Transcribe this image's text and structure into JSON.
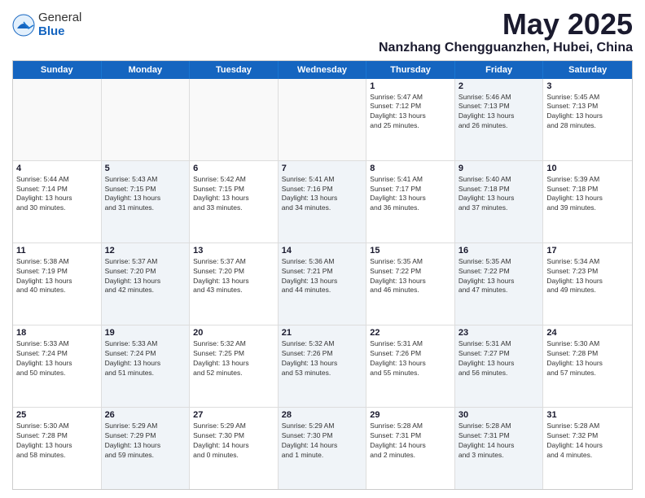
{
  "logo": {
    "general": "General",
    "blue": "Blue"
  },
  "header": {
    "month": "May 2025",
    "location": "Nanzhang Chengguanzhen, Hubei, China"
  },
  "weekdays": [
    "Sunday",
    "Monday",
    "Tuesday",
    "Wednesday",
    "Thursday",
    "Friday",
    "Saturday"
  ],
  "rows": [
    [
      {
        "day": "",
        "info": "",
        "shaded": false,
        "empty": true
      },
      {
        "day": "",
        "info": "",
        "shaded": false,
        "empty": true
      },
      {
        "day": "",
        "info": "",
        "shaded": false,
        "empty": true
      },
      {
        "day": "",
        "info": "",
        "shaded": false,
        "empty": true
      },
      {
        "day": "1",
        "info": "Sunrise: 5:47 AM\nSunset: 7:12 PM\nDaylight: 13 hours\nand 25 minutes.",
        "shaded": false,
        "empty": false
      },
      {
        "day": "2",
        "info": "Sunrise: 5:46 AM\nSunset: 7:13 PM\nDaylight: 13 hours\nand 26 minutes.",
        "shaded": true,
        "empty": false
      },
      {
        "day": "3",
        "info": "Sunrise: 5:45 AM\nSunset: 7:13 PM\nDaylight: 13 hours\nand 28 minutes.",
        "shaded": false,
        "empty": false
      }
    ],
    [
      {
        "day": "4",
        "info": "Sunrise: 5:44 AM\nSunset: 7:14 PM\nDaylight: 13 hours\nand 30 minutes.",
        "shaded": false,
        "empty": false
      },
      {
        "day": "5",
        "info": "Sunrise: 5:43 AM\nSunset: 7:15 PM\nDaylight: 13 hours\nand 31 minutes.",
        "shaded": true,
        "empty": false
      },
      {
        "day": "6",
        "info": "Sunrise: 5:42 AM\nSunset: 7:15 PM\nDaylight: 13 hours\nand 33 minutes.",
        "shaded": false,
        "empty": false
      },
      {
        "day": "7",
        "info": "Sunrise: 5:41 AM\nSunset: 7:16 PM\nDaylight: 13 hours\nand 34 minutes.",
        "shaded": true,
        "empty": false
      },
      {
        "day": "8",
        "info": "Sunrise: 5:41 AM\nSunset: 7:17 PM\nDaylight: 13 hours\nand 36 minutes.",
        "shaded": false,
        "empty": false
      },
      {
        "day": "9",
        "info": "Sunrise: 5:40 AM\nSunset: 7:18 PM\nDaylight: 13 hours\nand 37 minutes.",
        "shaded": true,
        "empty": false
      },
      {
        "day": "10",
        "info": "Sunrise: 5:39 AM\nSunset: 7:18 PM\nDaylight: 13 hours\nand 39 minutes.",
        "shaded": false,
        "empty": false
      }
    ],
    [
      {
        "day": "11",
        "info": "Sunrise: 5:38 AM\nSunset: 7:19 PM\nDaylight: 13 hours\nand 40 minutes.",
        "shaded": false,
        "empty": false
      },
      {
        "day": "12",
        "info": "Sunrise: 5:37 AM\nSunset: 7:20 PM\nDaylight: 13 hours\nand 42 minutes.",
        "shaded": true,
        "empty": false
      },
      {
        "day": "13",
        "info": "Sunrise: 5:37 AM\nSunset: 7:20 PM\nDaylight: 13 hours\nand 43 minutes.",
        "shaded": false,
        "empty": false
      },
      {
        "day": "14",
        "info": "Sunrise: 5:36 AM\nSunset: 7:21 PM\nDaylight: 13 hours\nand 44 minutes.",
        "shaded": true,
        "empty": false
      },
      {
        "day": "15",
        "info": "Sunrise: 5:35 AM\nSunset: 7:22 PM\nDaylight: 13 hours\nand 46 minutes.",
        "shaded": false,
        "empty": false
      },
      {
        "day": "16",
        "info": "Sunrise: 5:35 AM\nSunset: 7:22 PM\nDaylight: 13 hours\nand 47 minutes.",
        "shaded": true,
        "empty": false
      },
      {
        "day": "17",
        "info": "Sunrise: 5:34 AM\nSunset: 7:23 PM\nDaylight: 13 hours\nand 49 minutes.",
        "shaded": false,
        "empty": false
      }
    ],
    [
      {
        "day": "18",
        "info": "Sunrise: 5:33 AM\nSunset: 7:24 PM\nDaylight: 13 hours\nand 50 minutes.",
        "shaded": false,
        "empty": false
      },
      {
        "day": "19",
        "info": "Sunrise: 5:33 AM\nSunset: 7:24 PM\nDaylight: 13 hours\nand 51 minutes.",
        "shaded": true,
        "empty": false
      },
      {
        "day": "20",
        "info": "Sunrise: 5:32 AM\nSunset: 7:25 PM\nDaylight: 13 hours\nand 52 minutes.",
        "shaded": false,
        "empty": false
      },
      {
        "day": "21",
        "info": "Sunrise: 5:32 AM\nSunset: 7:26 PM\nDaylight: 13 hours\nand 53 minutes.",
        "shaded": true,
        "empty": false
      },
      {
        "day": "22",
        "info": "Sunrise: 5:31 AM\nSunset: 7:26 PM\nDaylight: 13 hours\nand 55 minutes.",
        "shaded": false,
        "empty": false
      },
      {
        "day": "23",
        "info": "Sunrise: 5:31 AM\nSunset: 7:27 PM\nDaylight: 13 hours\nand 56 minutes.",
        "shaded": true,
        "empty": false
      },
      {
        "day": "24",
        "info": "Sunrise: 5:30 AM\nSunset: 7:28 PM\nDaylight: 13 hours\nand 57 minutes.",
        "shaded": false,
        "empty": false
      }
    ],
    [
      {
        "day": "25",
        "info": "Sunrise: 5:30 AM\nSunset: 7:28 PM\nDaylight: 13 hours\nand 58 minutes.",
        "shaded": false,
        "empty": false
      },
      {
        "day": "26",
        "info": "Sunrise: 5:29 AM\nSunset: 7:29 PM\nDaylight: 13 hours\nand 59 minutes.",
        "shaded": true,
        "empty": false
      },
      {
        "day": "27",
        "info": "Sunrise: 5:29 AM\nSunset: 7:30 PM\nDaylight: 14 hours\nand 0 minutes.",
        "shaded": false,
        "empty": false
      },
      {
        "day": "28",
        "info": "Sunrise: 5:29 AM\nSunset: 7:30 PM\nDaylight: 14 hours\nand 1 minute.",
        "shaded": true,
        "empty": false
      },
      {
        "day": "29",
        "info": "Sunrise: 5:28 AM\nSunset: 7:31 PM\nDaylight: 14 hours\nand 2 minutes.",
        "shaded": false,
        "empty": false
      },
      {
        "day": "30",
        "info": "Sunrise: 5:28 AM\nSunset: 7:31 PM\nDaylight: 14 hours\nand 3 minutes.",
        "shaded": true,
        "empty": false
      },
      {
        "day": "31",
        "info": "Sunrise: 5:28 AM\nSunset: 7:32 PM\nDaylight: 14 hours\nand 4 minutes.",
        "shaded": false,
        "empty": false
      }
    ]
  ]
}
